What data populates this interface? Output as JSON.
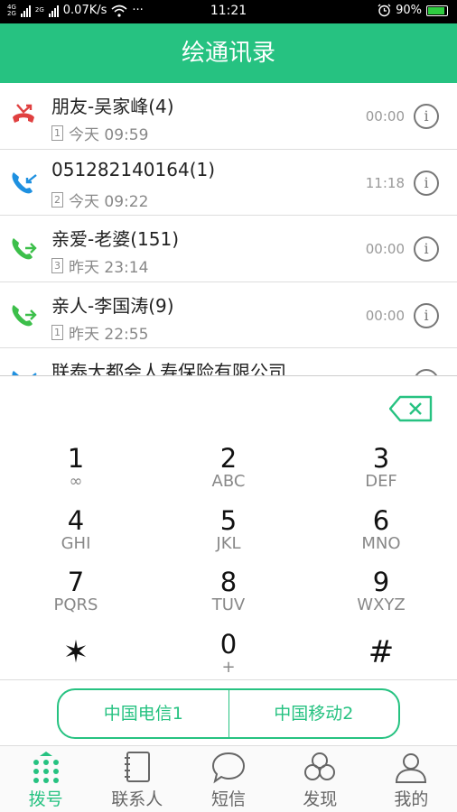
{
  "status_bar": {
    "network_top": "4G",
    "network_bottom": "2G",
    "network2": "2G",
    "speed": "0.07K/s",
    "dots": "···",
    "time": "11:21",
    "battery": "90%",
    "battery_level": 0.9
  },
  "header": {
    "title": "绘通讯录"
  },
  "calls": [
    {
      "name": "朋友-吴家峰(4)",
      "sim": "1",
      "time": "今天 09:59",
      "duration": "00:00",
      "type": "missed",
      "color": "#e04040"
    },
    {
      "name": "051282140164(1)",
      "sim": "2",
      "time": "今天 09:22",
      "duration": "11:18",
      "type": "incoming",
      "color": "#1e90e0"
    },
    {
      "name": "亲爱-老婆(151)",
      "sim": "3",
      "time": "昨天 23:14",
      "duration": "00:00",
      "type": "outgoing",
      "color": "#3cbf4a"
    },
    {
      "name": "亲人-李国涛(9)",
      "sim": "1",
      "time": "昨天 22:55",
      "duration": "00:00",
      "type": "outgoing",
      "color": "#3cbf4a"
    },
    {
      "name": "联泰大都会人寿保险有限公司…",
      "sim": "",
      "time": "",
      "duration": "",
      "type": "incoming",
      "color": "#1e90e0"
    }
  ],
  "keypad": [
    {
      "digit": "1",
      "letters": "∞"
    },
    {
      "digit": "2",
      "letters": "ABC"
    },
    {
      "digit": "3",
      "letters": "DEF"
    },
    {
      "digit": "4",
      "letters": "GHI"
    },
    {
      "digit": "5",
      "letters": "JKL"
    },
    {
      "digit": "6",
      "letters": "MNO"
    },
    {
      "digit": "7",
      "letters": "PQRS"
    },
    {
      "digit": "8",
      "letters": "TUV"
    },
    {
      "digit": "9",
      "letters": "WXYZ"
    },
    {
      "digit": "✶",
      "letters": ""
    },
    {
      "digit": "0",
      "letters": "+"
    },
    {
      "digit": "#",
      "letters": ""
    }
  ],
  "sim_buttons": [
    "中国电信1",
    "中国移动2"
  ],
  "tabs": [
    {
      "label": "拨号",
      "icon": "dialpad-icon",
      "active": true
    },
    {
      "label": "联系人",
      "icon": "contacts-book-icon",
      "active": false
    },
    {
      "label": "短信",
      "icon": "message-bubble-icon",
      "active": false
    },
    {
      "label": "发现",
      "icon": "discover-icon",
      "active": false
    },
    {
      "label": "我的",
      "icon": "profile-icon",
      "active": false
    }
  ],
  "colors": {
    "accent": "#26c281",
    "missed": "#e04040",
    "incoming": "#1e90e0",
    "outgoing": "#3cbf4a"
  }
}
